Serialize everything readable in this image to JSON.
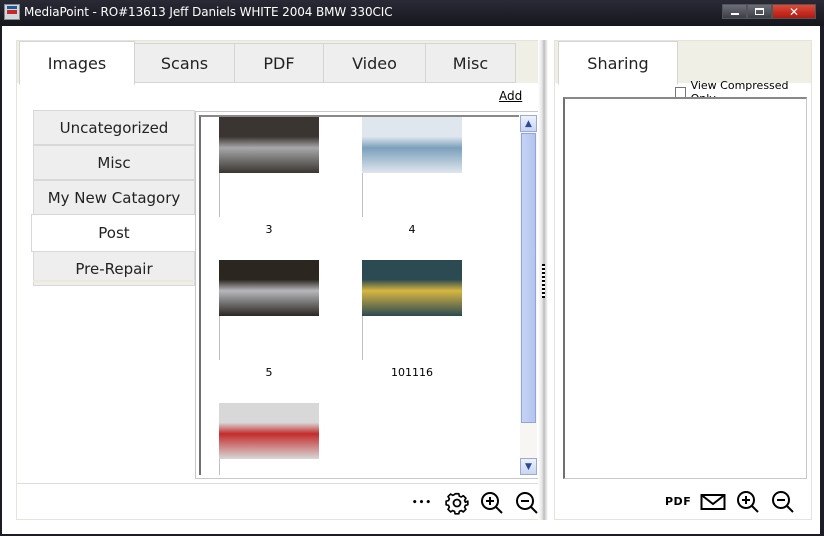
{
  "window": {
    "title": "MediaPoint - RO#13613 Jeff Daniels WHITE 2004 BMW 330CIC",
    "controls": {
      "minimize": "minimize",
      "maximize": "maximize",
      "close": "✕"
    }
  },
  "media_tabs": [
    {
      "label": "Images",
      "active": true
    },
    {
      "label": "Scans",
      "active": false
    },
    {
      "label": "PDF",
      "active": false
    },
    {
      "label": "Video",
      "active": false
    },
    {
      "label": "Misc",
      "active": false
    }
  ],
  "add_label": "Add",
  "categories": [
    {
      "label": "Uncategorized",
      "active": false
    },
    {
      "label": "Misc",
      "active": false
    },
    {
      "label": "My New Catagory",
      "active": false
    },
    {
      "label": "Post",
      "active": true
    },
    {
      "label": "Pre-Repair",
      "active": false
    }
  ],
  "thumbnails": [
    {
      "label": "3",
      "image": "silver roadster on display stand with person",
      "colors": [
        "#3a3530",
        "#a8a8aa"
      ]
    },
    {
      "label": "4",
      "image": "light blue speedster on white platform",
      "colors": [
        "#dfe6ee",
        "#7aa0bc"
      ]
    },
    {
      "label": "5",
      "image": "silver roadster at auto show",
      "colors": [
        "#2b2620",
        "#b8b8bc"
      ]
    },
    {
      "label": "101116",
      "image": "yellow BMW in showroom",
      "colors": [
        "#2c4a52",
        "#d8b640"
      ]
    },
    {
      "label": "",
      "image": "red and white race car",
      "colors": [
        "#d8d8d8",
        "#c42c2c"
      ]
    }
  ],
  "left_toolbar": {
    "more": "•••",
    "icons": [
      "more-icon",
      "gear-icon",
      "zoom-in-icon",
      "zoom-out-icon"
    ]
  },
  "sharing": {
    "tab_label": "Sharing",
    "view_compressed_label": "View Compressed Only",
    "view_compressed_checked": false,
    "pdf_label": "PDF",
    "icons": [
      "pdf-icon",
      "mail-icon",
      "zoom-in-icon",
      "zoom-out-icon"
    ]
  }
}
